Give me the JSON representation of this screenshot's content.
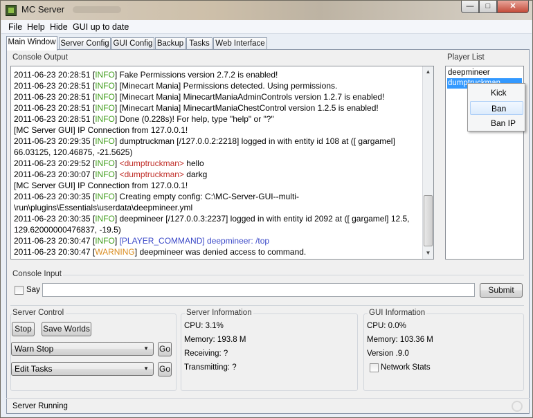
{
  "window": {
    "title": "MC Server"
  },
  "menu": [
    "File",
    "Help",
    "Hide",
    "GUI up to date"
  ],
  "tabs": [
    "Main Window",
    "Server Config",
    "GUI Config",
    "Backup",
    "Tasks",
    "Web Interface"
  ],
  "console": {
    "label": "Console Output",
    "lines": [
      [
        {
          "t": "2011-06-23 20:28:51 ["
        },
        {
          "t": "INFO",
          "c": "info"
        },
        {
          "t": "] Fake Permissions version 2.7.2 is enabled!"
        }
      ],
      [
        {
          "t": "2011-06-23 20:28:51 ["
        },
        {
          "t": "INFO",
          "c": "info"
        },
        {
          "t": "] [Minecart Mania] Permissions detected. Using permissions."
        }
      ],
      [
        {
          "t": "2011-06-23 20:28:51 ["
        },
        {
          "t": "INFO",
          "c": "info"
        },
        {
          "t": "] [Minecart Mania] MinecartManiaAdminControls version 1.2.7 is enabled!"
        }
      ],
      [
        {
          "t": "2011-06-23 20:28:51 ["
        },
        {
          "t": "INFO",
          "c": "info"
        },
        {
          "t": "] [Minecart Mania] MinecartManiaChestControl version 1.2.5 is enabled!"
        }
      ],
      [
        {
          "t": "2011-06-23 20:28:51 ["
        },
        {
          "t": "INFO",
          "c": "info"
        },
        {
          "t": "] Done (0.228s)! For help, type \"help\" or \"?\""
        }
      ],
      [
        {
          "t": "[MC Server GUI] IP Connection from 127.0.0.1!"
        }
      ],
      [
        {
          "t": "2011-06-23 20:29:35 ["
        },
        {
          "t": "INFO",
          "c": "info"
        },
        {
          "t": "] dumptruckman [/127.0.0.2:2218] logged in with entity id 108 at ([ gargamel] 66.03125, 120.46875, -21.5625)"
        }
      ],
      [
        {
          "t": "2011-06-23 20:29:52 ["
        },
        {
          "t": "INFO",
          "c": "info"
        },
        {
          "t": "] "
        },
        {
          "t": "<dumptruckman>",
          "c": "red"
        },
        {
          "t": " hello"
        }
      ],
      [
        {
          "t": "2011-06-23 20:30:07 ["
        },
        {
          "t": "INFO",
          "c": "info"
        },
        {
          "t": "] "
        },
        {
          "t": "<dumptruckman>",
          "c": "red"
        },
        {
          "t": " darkg"
        }
      ],
      [
        {
          "t": "[MC Server GUI] IP Connection from 127.0.0.1!"
        }
      ],
      [
        {
          "t": "2011-06-23 20:30:35 ["
        },
        {
          "t": "INFO",
          "c": "info"
        },
        {
          "t": "] Creating empty config: C:\\MC-Server-GUI--multi-\\run\\plugins\\Essentials\\userdata\\deepmineer.yml"
        }
      ],
      [
        {
          "t": "2011-06-23 20:30:35 ["
        },
        {
          "t": "INFO",
          "c": "info"
        },
        {
          "t": "] deepmineer [/127.0.0.3:2237] logged in with entity id 2092 at ([ gargamel] 12.5, 129.62000000476837, -19.5)"
        }
      ],
      [
        {
          "t": "2011-06-23 20:30:47 ["
        },
        {
          "t": "INFO",
          "c": "info"
        },
        {
          "t": "] "
        },
        {
          "t": "[PLAYER_COMMAND] deepmineer: /top",
          "c": "blue"
        }
      ],
      [
        {
          "t": "2011-06-23 20:30:47 ["
        },
        {
          "t": "WARNING",
          "c": "warn"
        },
        {
          "t": "] deepmineer was denied access to command."
        }
      ]
    ]
  },
  "player_list": {
    "label": "Player List",
    "players": [
      "deepmineer",
      "dumptruckman"
    ],
    "selected_index": 1
  },
  "context_menu": {
    "items": [
      "Kick",
      "Ban",
      "Ban IP"
    ],
    "hover_index": 1
  },
  "console_input": {
    "label": "Console Input",
    "say_label": "Say",
    "value": "",
    "submit_label": "Submit"
  },
  "server_control": {
    "label": "Server Control",
    "stop_label": "Stop",
    "save_worlds_label": "Save Worlds",
    "stop_select": "Warn Stop",
    "tasks_select": "Edit Tasks",
    "go_label": "Go"
  },
  "server_info": {
    "label": "Server Information",
    "cpu": "CPU:  3.1%",
    "memory": "Memory:  193.8 M",
    "receiving": "Receiving:  ?",
    "transmitting": "Transmitting:  ?"
  },
  "gui_info": {
    "label": "GUI Information",
    "cpu": "CPU:  0.0%",
    "memory": "Memory:  103.36 M",
    "version": "Version .9.0",
    "network_stats_label": "Network Stats"
  },
  "status": "Server Running",
  "colors": {
    "info": "#3f9d1a",
    "warn": "#d98b1d",
    "red": "#c0302a",
    "blue": "#3b49c8",
    "selection": "#3399ff"
  }
}
